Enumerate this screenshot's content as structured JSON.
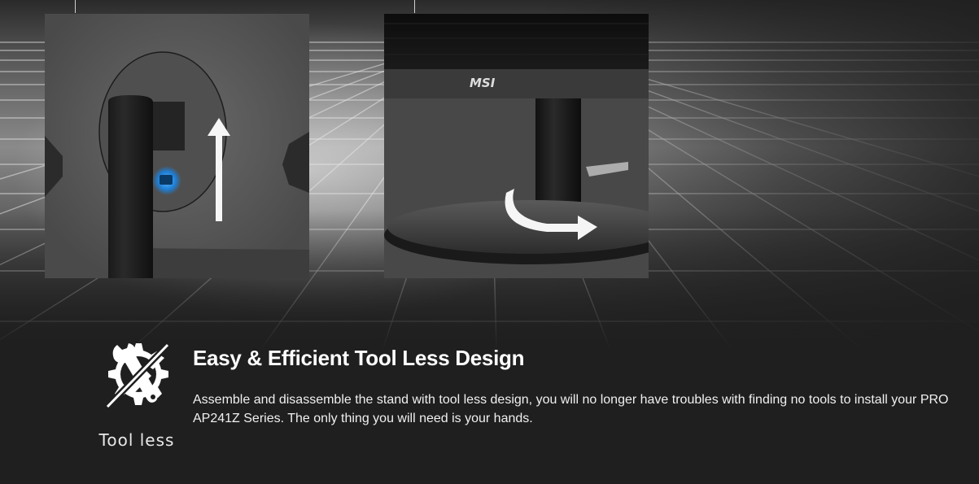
{
  "images": {
    "left_panel": {
      "icon": "height-adjust-arrow-icon"
    },
    "right_panel": {
      "logo_text": "MSI",
      "icon": "swivel-arrow-icon"
    }
  },
  "feature": {
    "badge_icon": "wrench-gear-crossed-icon",
    "badge_label": "Tool less",
    "title": "Easy & Efficient Tool Less Design",
    "description": "Assemble and disassemble the stand with tool less design, you will no longer have troubles with finding no tools to install your PRO AP241Z Series. The only thing you will need is your hands."
  },
  "colors": {
    "background": "#1f1f1f",
    "accent_blue": "#1e90ff",
    "text": "#ffffff"
  }
}
